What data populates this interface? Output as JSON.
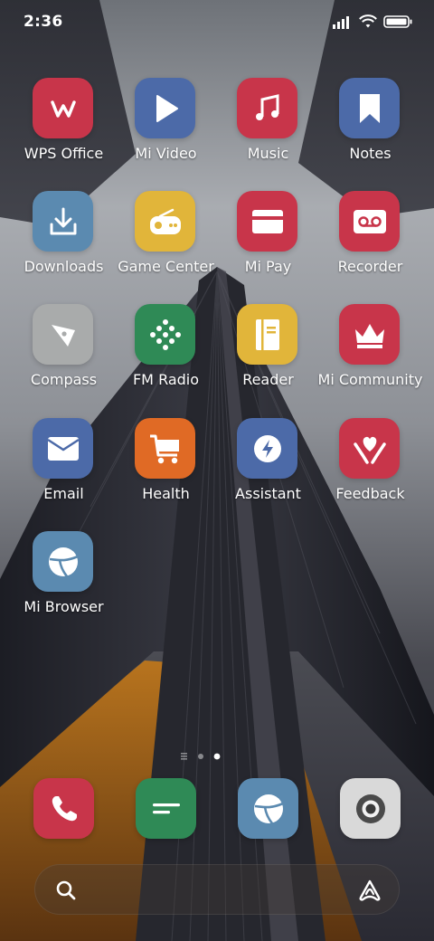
{
  "status_bar": {
    "time": "2:36",
    "icons": [
      "signal-icon",
      "wifi-icon",
      "battery-icon"
    ]
  },
  "apps": [
    {
      "label": "WPS Office",
      "icon": "wps-office-icon",
      "color": "#c8354a"
    },
    {
      "label": "Mi Video",
      "icon": "play-icon",
      "color": "#4c6aa8"
    },
    {
      "label": "Music",
      "icon": "music-note-icon",
      "color": "#c8354a"
    },
    {
      "label": "Notes",
      "icon": "bookmark-icon",
      "color": "#4c6aa8"
    },
    {
      "label": "Downloads",
      "icon": "download-icon",
      "color": "#5b8ab0"
    },
    {
      "label": "Game Center",
      "icon": "game-controller-icon",
      "color": "#e1b53a"
    },
    {
      "label": "Mi Pay",
      "icon": "card-icon",
      "color": "#c8354a"
    },
    {
      "label": "Recorder",
      "icon": "voicemail-icon",
      "color": "#c8354a"
    },
    {
      "label": "Compass",
      "icon": "compass-icon",
      "color": "#a9abab"
    },
    {
      "label": "FM Radio",
      "icon": "radio-dots-icon",
      "color": "#2f8a56"
    },
    {
      "label": "Reader",
      "icon": "book-icon",
      "color": "#e1b53a"
    },
    {
      "label": "Mi Community",
      "icon": "crown-icon",
      "color": "#c8354a"
    },
    {
      "label": "Email",
      "icon": "envelope-icon",
      "color": "#4c6aa8"
    },
    {
      "label": "Health",
      "icon": "cart-icon",
      "color": "#e06a25"
    },
    {
      "label": "Assistant",
      "icon": "lightning-icon",
      "color": "#4c6aa8"
    },
    {
      "label": "Feedback",
      "icon": "heart-hands-icon",
      "color": "#c8354a"
    },
    {
      "label": "Mi Browser",
      "icon": "globe-icon",
      "color": "#5b8ab0"
    }
  ],
  "page_indicator": {
    "pages": 2,
    "current": 2,
    "has_list_page": true
  },
  "dock": [
    {
      "name": "phone",
      "icon": "phone-icon",
      "color": "#c8354a"
    },
    {
      "name": "messages",
      "icon": "message-icon",
      "color": "#2f8a56"
    },
    {
      "name": "browser",
      "icon": "globe-icon",
      "color": "#5b8ab0"
    },
    {
      "name": "camera",
      "icon": "camera-icon",
      "color": "#d9d9d9"
    }
  ],
  "search_bar": {
    "icon": "search-icon",
    "assistant_icon": "assistant-icon"
  }
}
